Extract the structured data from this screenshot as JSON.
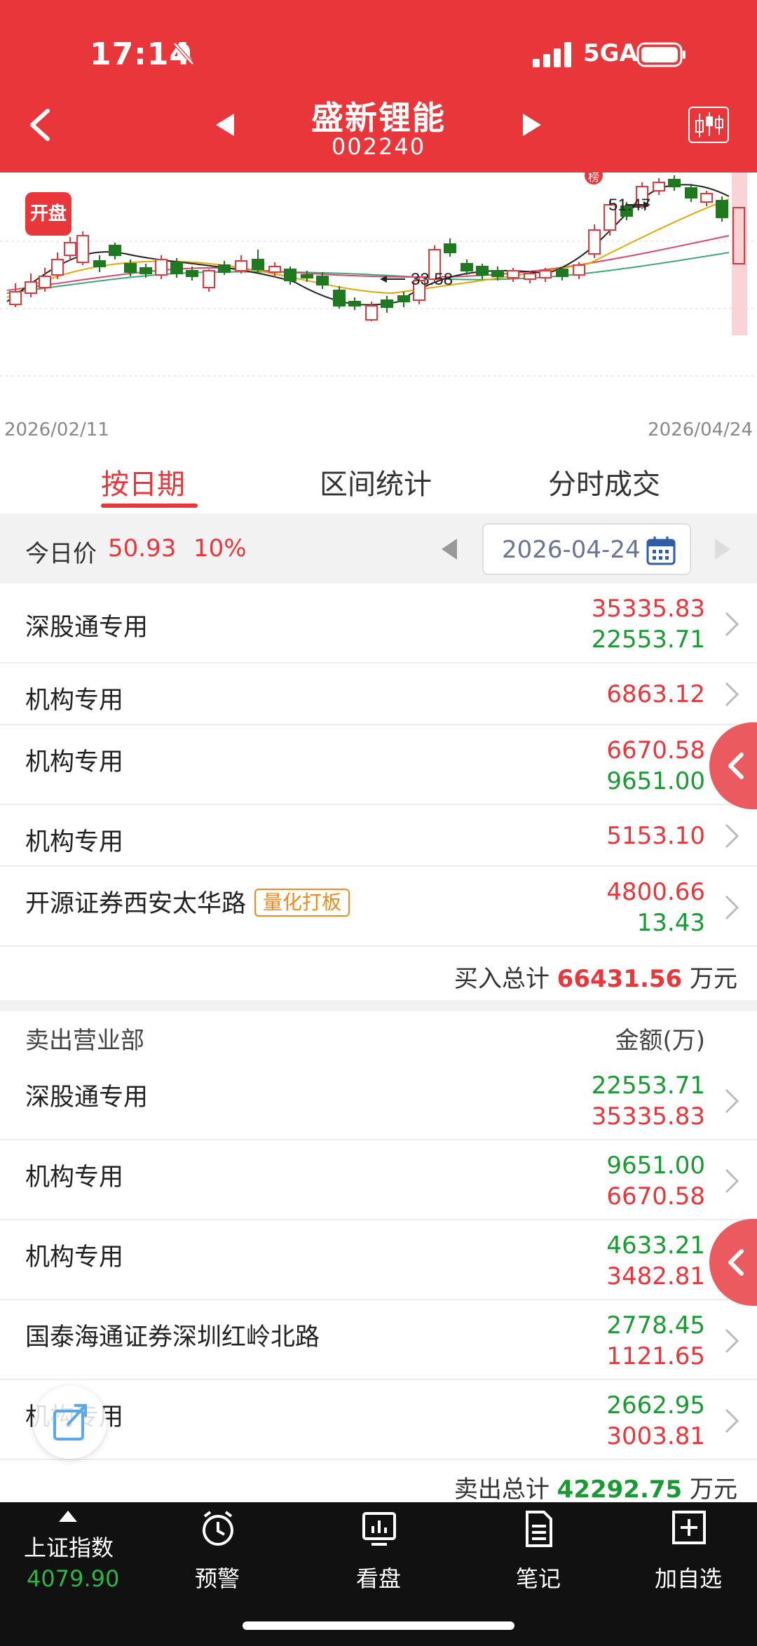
{
  "status_bar": {
    "time": "17:14",
    "network": "5GA"
  },
  "header": {
    "title": "盛新锂能",
    "code": "002240"
  },
  "chart": {
    "badge": "开盘",
    "start_date": "2026/02/11",
    "end_date": "2026/04/24",
    "high_label": "51.47",
    "low_label": "33.58",
    "rank_tag": "榜",
    "colors": {
      "up": "#e8363a",
      "down": "#1f7a1f",
      "ma5": "#222222",
      "ma10": "#e0a800",
      "ma20": "#d9486f",
      "ma30": "#3aa87a"
    }
  },
  "tabs": [
    {
      "label": "按日期",
      "active": true
    },
    {
      "label": "区间统计",
      "active": false
    },
    {
      "label": "分时成交",
      "active": false
    }
  ],
  "price_bar": {
    "label": "今日价",
    "price": "50.93",
    "change": "10%",
    "date": "2026-04-24"
  },
  "buy": {
    "rows": [
      {
        "name": "深股通专用",
        "v1": "35335.83",
        "v2": "22553.71",
        "tag": ""
      },
      {
        "name": "机构专用",
        "v1": "6863.12",
        "v2": "",
        "tag": ""
      },
      {
        "name": "机构专用",
        "v1": "6670.58",
        "v2": "9651.00",
        "tag": ""
      },
      {
        "name": "机构专用",
        "v1": "5153.10",
        "v2": "",
        "tag": ""
      },
      {
        "name": "开源证券西安太华路",
        "v1": "4800.66",
        "v2": "13.43",
        "tag": "量化打板"
      }
    ],
    "total_label": "买入总计",
    "total_value": "66431.56",
    "total_unit": "万元"
  },
  "sell": {
    "header_left": "卖出营业部",
    "header_right": "金额(万)",
    "rows": [
      {
        "name": "深股通专用",
        "v1": "22553.71",
        "v2": "35335.83"
      },
      {
        "name": "机构专用",
        "v1": "9651.00",
        "v2": "6670.58"
      },
      {
        "name": "机构专用",
        "v1": "4633.21",
        "v2": "3482.81"
      },
      {
        "name": "国泰海通证券深圳红岭北路",
        "v1": "2778.45",
        "v2": "1121.65"
      },
      {
        "name": "机构专用",
        "v1": "2662.95",
        "v2": "3003.81"
      }
    ],
    "total_label": "卖出总计",
    "total_value": "42292.75",
    "total_unit": "万元"
  },
  "bottom_nav": {
    "index_name": "上证指数",
    "index_value": "4079.90",
    "items": [
      {
        "label": "预警",
        "icon": "alarm-clock-icon"
      },
      {
        "label": "看盘",
        "icon": "monitor-chart-icon"
      },
      {
        "label": "笔记",
        "icon": "note-icon"
      },
      {
        "label": "加自选",
        "icon": "add-box-icon"
      }
    ]
  }
}
